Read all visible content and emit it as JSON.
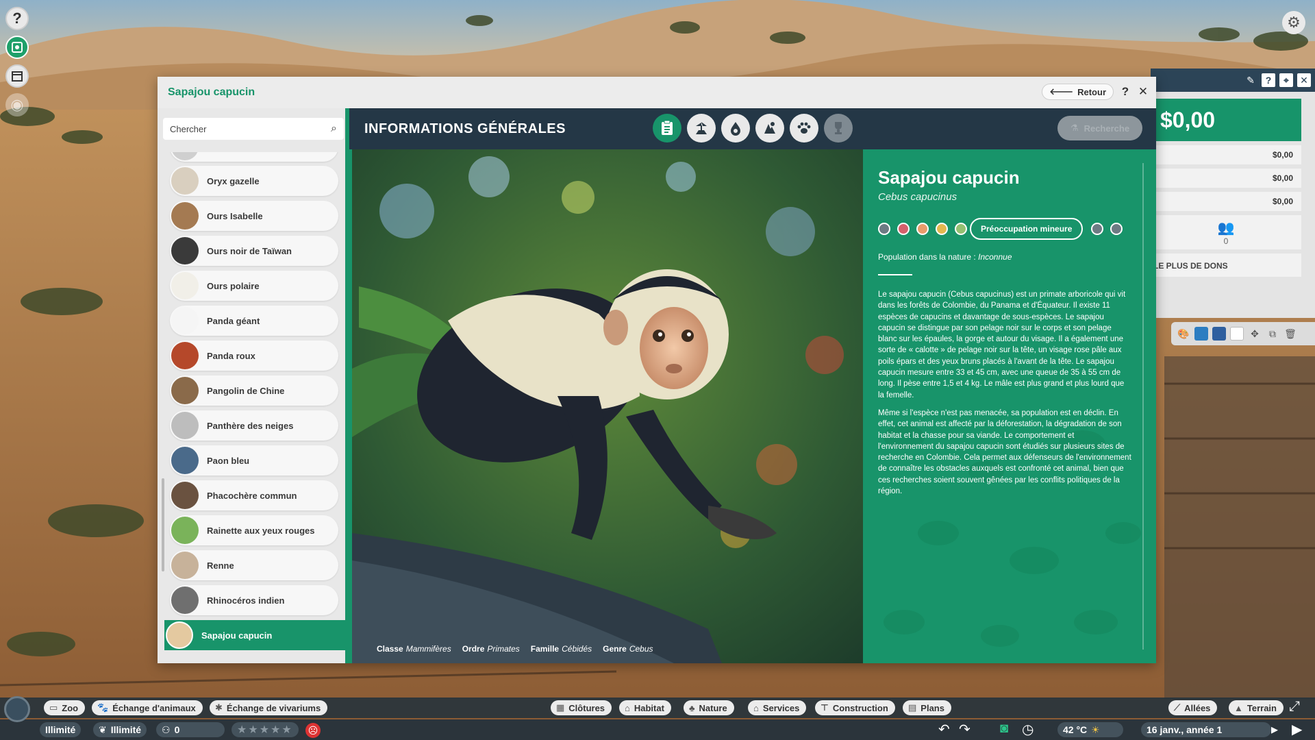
{
  "window": {
    "title": "Sapajou capucin",
    "back_label": "Retour",
    "help_label": "?",
    "close_label": "✕"
  },
  "search": {
    "placeholder": "Chercher"
  },
  "animals": [
    {
      "name": "Oryx gazelle",
      "icon": "oryx-thumbnail"
    },
    {
      "name": "Ours Isabelle",
      "icon": "brown-bear-thumbnail"
    },
    {
      "name": "Ours noir de Taïwan",
      "icon": "black-bear-thumbnail"
    },
    {
      "name": "Ours polaire",
      "icon": "polar-bear-thumbnail"
    },
    {
      "name": "Panda géant",
      "icon": "panda-thumbnail"
    },
    {
      "name": "Panda roux",
      "icon": "red-panda-thumbnail"
    },
    {
      "name": "Pangolin de Chine",
      "icon": "pangolin-thumbnail"
    },
    {
      "name": "Panthère des neiges",
      "icon": "snow-leopard-thumbnail"
    },
    {
      "name": "Paon bleu",
      "icon": "peacock-thumbnail"
    },
    {
      "name": "Phacochère commun",
      "icon": "warthog-thumbnail"
    },
    {
      "name": "Rainette aux yeux rouges",
      "icon": "frog-thumbnail"
    },
    {
      "name": "Renne",
      "icon": "reindeer-thumbnail"
    },
    {
      "name": "Rhinocéros indien",
      "icon": "rhino-thumbnail"
    },
    {
      "name": "Sapajou capucin",
      "icon": "capuchin-thumbnail",
      "selected": true
    }
  ],
  "content": {
    "heading": "INFORMATIONS GÉNÉRALES",
    "tabs": [
      {
        "name": "general-info",
        "icon": "clipboard-icon",
        "active": true
      },
      {
        "name": "habitat",
        "icon": "habitat-icon"
      },
      {
        "name": "diet",
        "icon": "drop-icon"
      },
      {
        "name": "enrichment",
        "icon": "enrichment-icon"
      },
      {
        "name": "behaviour",
        "icon": "paw-icon"
      },
      {
        "name": "achievements",
        "icon": "trophy-icon",
        "disabled": true
      }
    ],
    "research_label": "Recherche"
  },
  "species": {
    "name": "Sapajou capucin",
    "latin": "Cebus capucinus",
    "status": "Préoccupation mineure",
    "population_label": "Population dans la nature :",
    "population_value": "Inconnue",
    "description_1": "Le sapajou capucin (Cebus capucinus) est un primate arboricole qui vit dans les forêts de Colombie, du Panama et d'Équateur. Il existe 11 espèces de capucins et davantage de sous-espèces. Le sapajou capucin se distingue par son pelage noir sur le corps et son pelage blanc sur les épaules, la gorge et autour du visage. Il a également une sorte de « calotte » de pelage noir sur la tête, un visage rose pâle aux poils épars et des yeux bruns placés à l'avant de la tête. Le sapajou capucin mesure entre 33 et 45 cm, avec une queue de 35 à 55 cm de long. Il pèse entre 1,5 et 4 kg. Le mâle est plus grand et plus lourd que la femelle.",
    "description_2": "Même si l'espèce n'est pas menacée, sa population est en déclin. En effet, cet animal est affecté par la déforestation, la dégradation de son habitat et la chasse pour sa viande. Le comportement et l'environnement du sapajou capucin sont étudiés sur plusieurs sites de recherche en Colombie. Cela permet aux défenseurs de l'environnement de connaître les obstacles auxquels est confronté cet animal, bien que ces recherches soient souvent gênées par les conflits politiques de la région.",
    "taxonomy": {
      "classe_label": "Classe",
      "classe": "Mammifères",
      "ordre_label": "Ordre",
      "ordre": "Primates",
      "famille_label": "Famille",
      "famille": "Cébidés",
      "genre_label": "Genre",
      "genre": "Cebus"
    }
  },
  "right_panel": {
    "money": "$0,00",
    "rows": [
      "$0,00",
      "$0,00",
      "$0,00"
    ],
    "donors_count": "0",
    "top_donors_label": "LE PLUS DE DONS"
  },
  "bottom_bar": {
    "row1_left": [
      {
        "label": "Zoo",
        "icon": "zoo-icon"
      },
      {
        "label": "Échange d'animaux",
        "icon": "paw-icon"
      },
      {
        "label": "Échange de vivariums",
        "icon": "bug-icon"
      }
    ],
    "row1_center": [
      {
        "label": "Clôtures",
        "icon": "fence-icon"
      },
      {
        "label": "Habitat",
        "icon": "habitat-icon"
      },
      {
        "label": "Nature",
        "icon": "tree-icon"
      },
      {
        "label": "Services",
        "icon": "building-icon"
      },
      {
        "label": "Construction",
        "icon": "construction-icon"
      },
      {
        "label": "Plans",
        "icon": "blueprint-icon"
      }
    ],
    "row1_right": [
      {
        "label": "Allées",
        "icon": "path-icon"
      },
      {
        "label": "Terrain",
        "icon": "terrain-icon"
      }
    ],
    "funds": "Illimité",
    "research": "Illimité",
    "guests": "0",
    "temperature": "42 °C",
    "date": "16 janv., année 1"
  }
}
